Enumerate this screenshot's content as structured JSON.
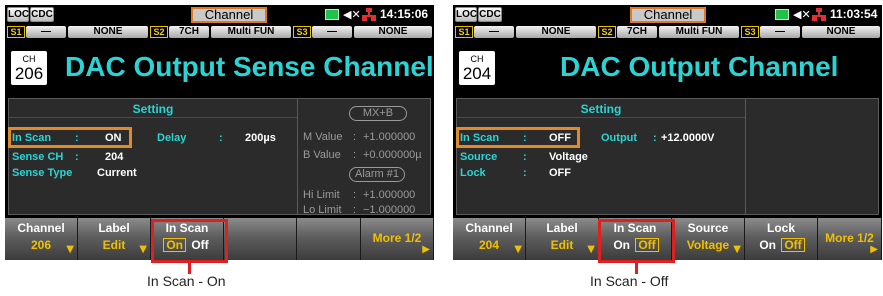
{
  "left": {
    "status": {
      "loc": "LOC",
      "cdc": "CDC",
      "title": "Channel",
      "time": "14:15:06"
    },
    "slots": {
      "s1": "S1",
      "s1_value": "—",
      "s1_card": "NONE",
      "s2": "S2",
      "s2_value": "7CH",
      "s2_card": "Multi FUN",
      "s3": "S3",
      "s3_value": "—",
      "s3_card": "NONE"
    },
    "channel_label": "CH",
    "channel_number": "206",
    "title": "DAC Output Sense Channel",
    "setting_label": "Setting",
    "settings": {
      "in_scan_key": "In Scan",
      "in_scan_value": "ON",
      "sense_ch_key": "Sense CH",
      "sense_ch_value": "204",
      "sense_type_key": "Sense Type",
      "sense_type_value": "Current",
      "delay_key": "Delay",
      "delay_value": "200µs",
      "colon": ":"
    },
    "math": {
      "mxb": "MX+B",
      "m_key": "M Value",
      "m_value": "+1.000000",
      "b_key": "B Value",
      "b_value": "+0.000000µ",
      "alarm": "Alarm #1",
      "hi_key": "Hi Limit",
      "hi_value": "+1.000000",
      "lo_key": "Lo Limit",
      "lo_value": "−1.000000"
    },
    "softkeys": {
      "channel_top": "Channel",
      "channel_bottom": "206",
      "label_top": "Label",
      "label_bottom": "Edit",
      "inscan_top": "In Scan",
      "inscan_on": "On",
      "inscan_off": "Off",
      "more": "More 1/2"
    },
    "caption": "In Scan - On"
  },
  "right": {
    "status": {
      "loc": "LOC",
      "cdc": "CDC",
      "title": "Channel",
      "time": "11:03:54"
    },
    "slots": {
      "s1": "S1",
      "s1_value": "—",
      "s1_card": "NONE",
      "s2": "S2",
      "s2_value": "7CH",
      "s2_card": "Multi FUN",
      "s3": "S3",
      "s3_value": "—",
      "s3_card": "NONE"
    },
    "channel_label": "CH",
    "channel_number": "204",
    "title": "DAC Output Channel",
    "setting_label": "Setting",
    "settings": {
      "in_scan_key": "In Scan",
      "in_scan_value": "OFF",
      "source_key": "Source",
      "source_value": "Voltage",
      "lock_key": "Lock",
      "lock_value": "OFF",
      "output_key": "Output",
      "output_value": "+12.0000V",
      "colon": ":"
    },
    "softkeys": {
      "channel_top": "Channel",
      "channel_bottom": "204",
      "label_top": "Label",
      "label_bottom": "Edit",
      "inscan_top": "In Scan",
      "inscan_on": "On",
      "inscan_off": "Off",
      "source_top": "Source",
      "source_bottom": "Voltage",
      "lock_top": "Lock",
      "lock_on": "On",
      "lock_off": "Off",
      "more": "More 1/2"
    },
    "caption": "In Scan - Off"
  },
  "colors": {
    "accent_cyan": "#2bd4d4",
    "softkey_yellow": "#f0c000",
    "highlight_orange": "#e08b2a",
    "callout_red": "#e02020",
    "status_green": "#21c24b"
  }
}
